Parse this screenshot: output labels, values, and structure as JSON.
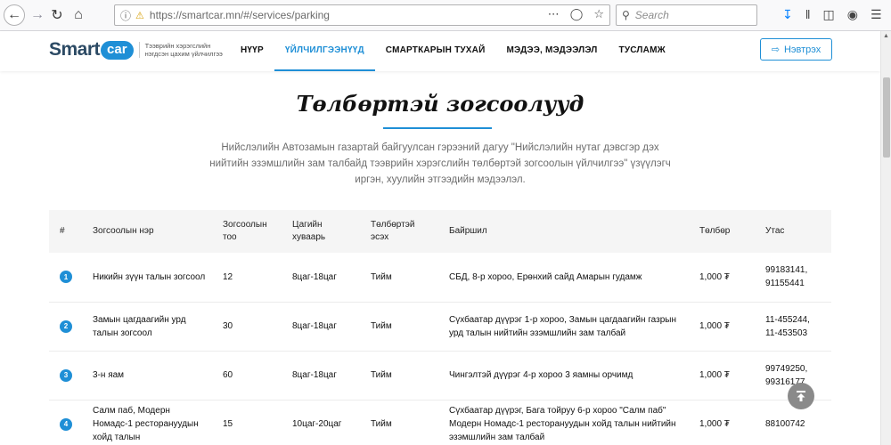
{
  "browser": {
    "url": "https://smartcar.mn/#/services/parking",
    "search_placeholder": "Search"
  },
  "brand": {
    "logo_smart": "Smart",
    "logo_car": "car",
    "tagline": "Тээврийн хэрэгслийн нэгдсэн цахим үйлчилгээ"
  },
  "nav": {
    "items": [
      {
        "label": "НҮҮР"
      },
      {
        "label": "ҮЙЛЧИЛГЭЭНҮҮД"
      },
      {
        "label": "СМАРТКАРЫН ТУХАЙ"
      },
      {
        "label": "МЭДЭЭ, МЭДЭЭЛЭЛ"
      },
      {
        "label": "ТУСЛАМЖ"
      }
    ],
    "active_index": 1,
    "login_label": "Нэвтрэх"
  },
  "page": {
    "title": "Төлбөртэй зогсоолууд",
    "intro": "Нийслэлийн Автозамын газартай байгуулсан гэрээний дагуу \"Нийслэлийн нутаг дэвсгэр дэх нийтийн эзэмшлийн зам талбайд тээврийн хэрэгслийн төлбөртэй зогсоолын үйлчилгээ\" үзүүлэгч иргэн, хуулийн этгээдийн мэдээлэл."
  },
  "table": {
    "headers": {
      "idx": "#",
      "name": "Зогсоолын нэр",
      "count": "Зогсоолын тоо",
      "hours": "Цагийн хуваарь",
      "paid": "Төлбөртэй эсэх",
      "location": "Байршил",
      "fee": "Төлбөр",
      "phone": "Утас"
    },
    "rows": [
      {
        "idx": "1",
        "name": "Никийн зүүн талын зогсоол",
        "count": "12",
        "hours": "8цаг-18цаг",
        "paid": "Тийм",
        "location": "СБД, 8-р хороо, Ерөнхий сайд Амарын гудамж",
        "fee": "1,000 ₮",
        "phone": "99183141, 91155441"
      },
      {
        "idx": "2",
        "name": "Замын цагдаагийн урд талын зогсоол",
        "count": "30",
        "hours": "8цаг-18цаг",
        "paid": "Тийм",
        "location": "Сүхбаатар дүүрэг 1-р хороо, Замын цагдаагийн газрын урд талын нийтийн эзэмшлийн зам талбай",
        "fee": "1,000 ₮",
        "phone": "11-455244, 11-453503"
      },
      {
        "idx": "3",
        "name": "3-н яам",
        "count": "60",
        "hours": "8цаг-18цаг",
        "paid": "Тийм",
        "location": "Чингэлтэй дүүрэг 4-р хороо 3 яамны орчимд",
        "fee": "1,000 ₮",
        "phone": "99749250, 99316177"
      },
      {
        "idx": "4",
        "name": "Салм паб, Модерн Номадс-1 ресторануудын хойд талын",
        "count": "15",
        "hours": "10цаг-20цаг",
        "paid": "Тийм",
        "location": "Сүхбаатар дүүрэг, Бага тойруу 6-р хороо \"Салм паб\" Модерн Номадс-1 ресторануудын хойд талын нийтийн эзэмшлийн зам талбай",
        "fee": "1,000 ₮",
        "phone": "88100742"
      }
    ]
  },
  "colors": {
    "accent": "#1f8fd6",
    "brand_dark": "#2c4a64",
    "to_top_button": "#8a8a8a"
  }
}
